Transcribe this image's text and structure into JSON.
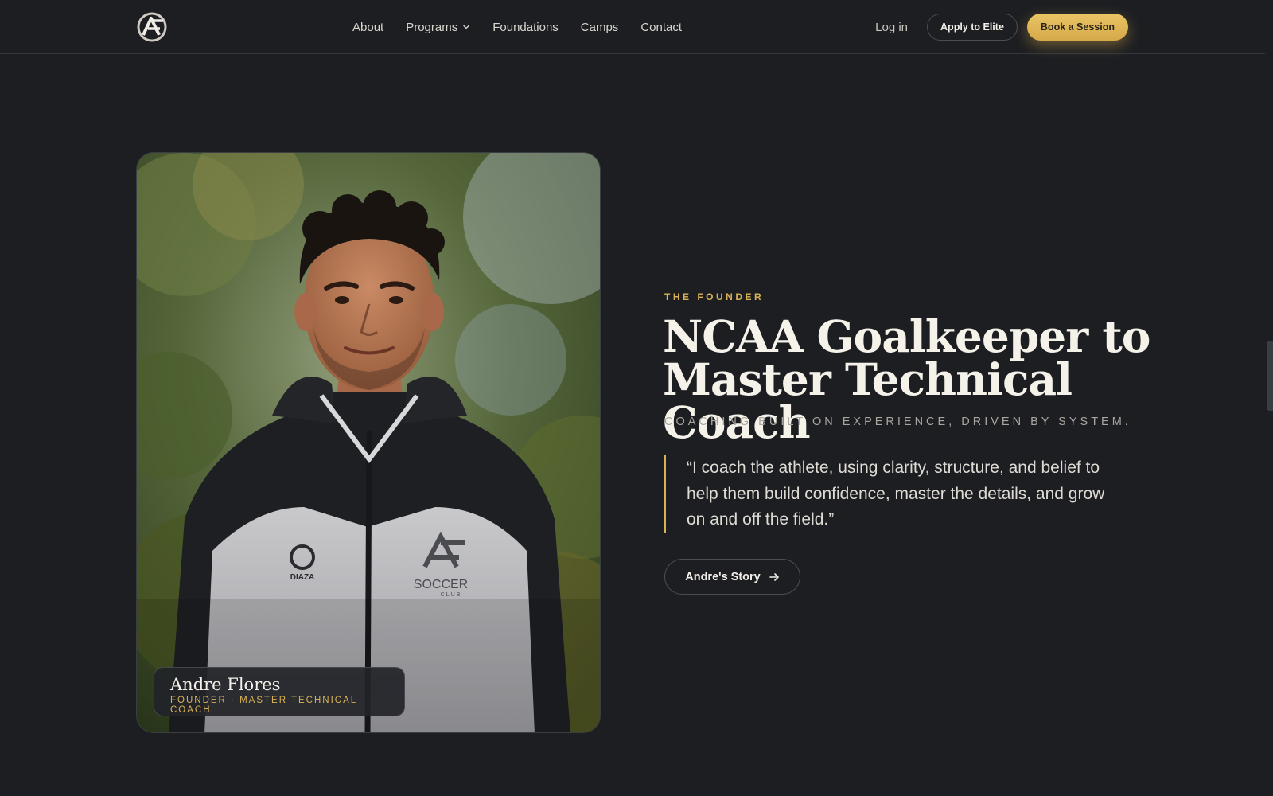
{
  "nav": {
    "brand": "AF Soccer Club",
    "links": [
      {
        "label": "About"
      },
      {
        "label": "Programs"
      },
      {
        "label": "Foundations"
      },
      {
        "label": "Camps"
      },
      {
        "label": "Contact"
      }
    ],
    "login": "Log in",
    "apply": "Apply to Elite",
    "book": "Book a Session"
  },
  "founder": {
    "eyebrow": "THE FOUNDER",
    "headline_line1": "NCAA Goalkeeper to",
    "headline_line2": "Master Technical Coach",
    "subline": "COACHING BUILT ON EXPERIENCE, DRIVEN BY SYSTEM.",
    "quote": "“I coach the athlete, using clarity, structure, and belief to help them build confidence, master the details, and grow on and off the field.”",
    "cta": "Andre's Story",
    "photo": {
      "name": "Andre Flores",
      "role": "FOUNDER · MASTER TECHNICAL COACH",
      "jacket_brand": "DIAZA",
      "jacket_club": "SOCCER",
      "jacket_club_sub": "CLUB"
    }
  },
  "colors": {
    "background": "#1c1e22",
    "accent_gold": "#d9b257",
    "text": "#f5f2ea"
  },
  "icons": [
    "logo-icon",
    "chevron-down-icon",
    "arrow-right-icon"
  ]
}
